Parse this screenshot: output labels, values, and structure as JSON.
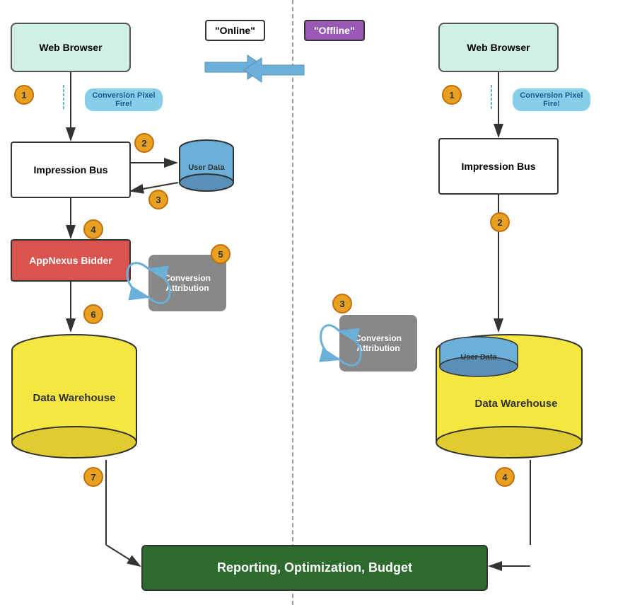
{
  "header": {
    "online_label": "\"Online\"",
    "offline_label": "\"Offline\""
  },
  "left_side": {
    "web_browser": "Web Browser",
    "impression_bus": "Impression Bus",
    "appnexus_bidder": "AppNexus Bidder",
    "data_warehouse": "Data Warehouse",
    "user_data": "User Data",
    "pixel_fire": "Conversion Pixel Fire!",
    "badges": [
      "1",
      "2",
      "3",
      "4",
      "5",
      "6",
      "7"
    ]
  },
  "right_side": {
    "web_browser": "Web Browser",
    "impression_bus": "Impression Bus",
    "data_warehouse": "Data Warehouse",
    "user_data": "User Data",
    "pixel_fire": "Conversion Pixel Fire!",
    "badges": [
      "1",
      "2",
      "3",
      "4"
    ]
  },
  "shared": {
    "conversion_attribution": "Conversion Attribution",
    "reporting": "Reporting, Optimization, Budget"
  }
}
